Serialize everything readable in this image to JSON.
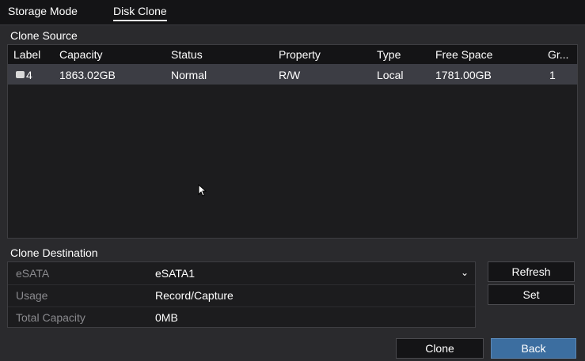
{
  "tabs": [
    {
      "label": "Storage Mode",
      "active": false
    },
    {
      "label": "Disk Clone",
      "active": true
    }
  ],
  "clone_source": {
    "title": "Clone Source",
    "columns": [
      "Label",
      "Capacity",
      "Status",
      "Property",
      "Type",
      "Free Space",
      "Gr..."
    ],
    "rows": [
      {
        "label": "4",
        "capacity": "1863.02GB",
        "status": "Normal",
        "property": "R/W",
        "type": "Local",
        "free_space": "1781.00GB",
        "group": "1",
        "icon": "hdd-icon"
      }
    ]
  },
  "clone_destination": {
    "title": "Clone Destination",
    "fields": [
      {
        "label": "eSATA",
        "value": "eSATA1",
        "dropdown": true
      },
      {
        "label": "Usage",
        "value": "Record/Capture"
      },
      {
        "label": "Total Capacity",
        "value": "0MB"
      }
    ]
  },
  "buttons": {
    "refresh": "Refresh",
    "set": "Set",
    "clone": "Clone",
    "back": "Back"
  },
  "colors": {
    "background": "#2a2a2d",
    "panel": "#1c1c1e",
    "selected_row": "#3c3d44",
    "accent_button": "#3c6ea0"
  }
}
